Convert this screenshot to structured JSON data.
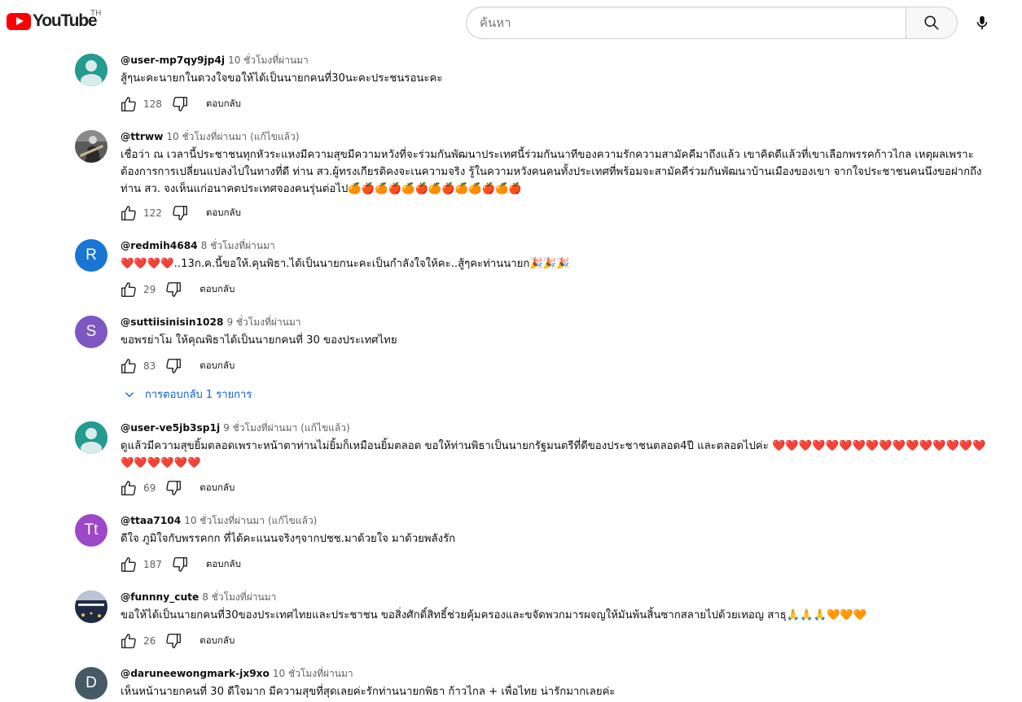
{
  "header": {
    "logo_text": "YouTube",
    "country_code": "TH",
    "search_placeholder": "ค้นหา",
    "search_icon": "search-icon",
    "mic_icon": "mic-icon"
  },
  "comments": [
    {
      "author": "@user-mp7qy9jp4j",
      "time": "10 ชั่วโมงที่ผ่านมา",
      "edited": "",
      "text": "สู้ๆนะคะนายกในดวงใจขอให้ได้เป็นนายกคนที่30นะคะประชนรอนะคะ",
      "likes": "128",
      "reply_label": "ตอบกลับ",
      "avatar": "default"
    },
    {
      "author": "@ttrww",
      "time": "10 ชั่วโมงที่ผ่านมา",
      "edited": "(แก้ไขแล้ว)",
      "text": "เชื่อว่า ณ เวลานี้ประชาชนทุกหัวระแหงมีความสุขมีความหวังที่จะร่วมกันพัฒนาประเทศนี้ร่วมกันนาทีของความรักความสามัคคีมาถึงแล้ว เขาคิดดีแล้วที่เขาเลือกพรรคก้าวไกล เหตุผลเพราะต้องการการเปลี่ยนแปลงไปในทางที่ดี ท่าน สว.ผู้ทรงเกียรติคงจะเนความจริง รู้ในความหวังคนคนทั้งประเทศที่พร้อมจะสามัคคีร่วมกันพัฒนาบ้านเมืองของเขา จากใจประชาชนคนนึงขอฝากถึงท่าน สว. จงเห็นแก่อนาคตประเทศจองคนรุ่นต่อไป🍊🍎🍊🍎🍊🍎🍊🍎🍊🍊🍎🍊🍎",
      "likes": "122",
      "reply_label": "ตอบกลับ",
      "avatar": "photo-guitar"
    },
    {
      "author": "@redmih4684",
      "time": "8 ชั่วโมงที่ผ่านมา",
      "edited": "",
      "text": "❤️❤️❤️❤️..13ก.ค.นี้ขอให้.คุนพิธา.ได้เป็นนายกนะคะเป็นกำลังใจให้คะ..สู้ๆคะท่านนายก🎉🎉🎉",
      "likes": "29",
      "reply_label": "ตอบกลับ",
      "avatar": "letter",
      "avatar_letter": "R",
      "avatar_color": "#1976d2"
    },
    {
      "author": "@suttiisinisin1028",
      "time": "9 ชั่วโมงที่ผ่านมา",
      "edited": "",
      "text": "ขอพรย่าโม ให้คุณพิธาได้เป็นนายกคนที่ 30 ของประเทศไทย",
      "likes": "83",
      "reply_label": "ตอบกลับ",
      "avatar": "letter",
      "avatar_letter": "S",
      "avatar_color": "#7e57c2",
      "replies_label": "การตอบกลับ 1 รายการ"
    },
    {
      "author": "@user-ve5jb3sp1j",
      "time": "9 ชั่วโมงที่ผ่านมา",
      "edited": "(แก้ไขแล้ว)",
      "text": "ดูแล้วมีความสุขยิ้มตลอดเพราะหน้าตาท่านไม่ยิ้มก็เหมือนยิ้มตลอด  ขอให้ท่านพิธาเป็นนายกรัฐมนตรีที่ดีของประชาชนตลอด4ปี  และตลอดไปค่ะ ❤️❤️❤️❤️❤️❤️❤️❤️❤️❤️❤️❤️❤️❤️❤️❤️❤️❤️❤️❤️❤️❤️",
      "likes": "69",
      "reply_label": "ตอบกลับ",
      "avatar": "default"
    },
    {
      "author": "@ttaa7104",
      "time": "10 ชั่วโมงที่ผ่านมา",
      "edited": "(แก้ไขแล้ว)",
      "text": "ดีใจ ภูมิใจกับพรรคกก ที่ได้คะแนนจริงๆจากปชช.มาด้วยใจ มาด้วยพลังรัก",
      "likes": "187",
      "reply_label": "ตอบกลับ",
      "avatar": "letter",
      "avatar_letter": "Tt",
      "avatar_color": "#9c48c9"
    },
    {
      "author": "@funnny_cute",
      "time": "8 ชั่วโมงที่ผ่านมา",
      "edited": "",
      "text": "ขอให้ได้เป็นนายกคนที่30ของประเทศไทยและประชาชน ขอสิ่งศักดิ์สิทธิ์ช่วยคุ้มครองและขจัดพวกมารผจญให้มันพ้นสิ้นซากสลายไปด้วยเทอญ สาธุ🙏🙏🙏🧡🧡🧡",
      "likes": "26",
      "reply_label": "ตอบกลับ",
      "avatar": "photo-night"
    },
    {
      "author": "@daruneewongmark-jx9xo",
      "time": "10 ชั่วโมงที่ผ่านมา",
      "edited": "",
      "text": "เห็นหน้านายกคนที่ 30 ดีใจมาก มีความสุขที่สุดเลยค่ะรักท่านนายกพิธา ก้าวไกล + เพื่อไทย น่ารักมากเลยค่ะ",
      "likes": "",
      "reply_label": "",
      "avatar": "letter",
      "avatar_letter": "D",
      "avatar_color": "#455a64"
    }
  ],
  "icons": {
    "like": "thumbs-up-icon",
    "dislike": "thumbs-down-icon",
    "expand": "chevron-down-icon"
  }
}
